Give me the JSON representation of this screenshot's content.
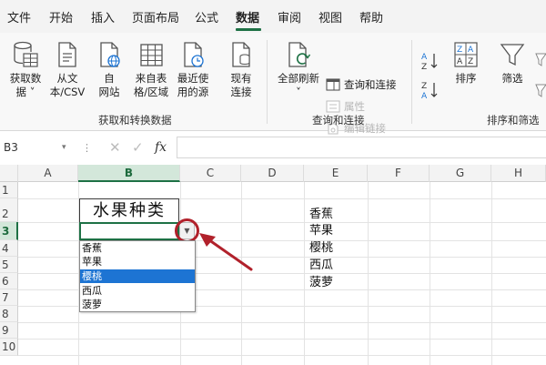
{
  "menu": {
    "tabs": [
      {
        "label": "文件"
      },
      {
        "label": "开始"
      },
      {
        "label": "插入"
      },
      {
        "label": "页面布局"
      },
      {
        "label": "公式"
      },
      {
        "label": "数据"
      },
      {
        "label": "审阅"
      },
      {
        "label": "视图"
      },
      {
        "label": "帮助"
      }
    ],
    "active_tab": "数据"
  },
  "ribbon": {
    "get_transform": {
      "group_label": "获取和转换数据",
      "buttons": [
        {
          "line1": "获取数",
          "line2": "据 ˅"
        },
        {
          "line1": "从文",
          "line2": "本/CSV"
        },
        {
          "line1": "自",
          "line2": "网站"
        },
        {
          "line1": "来自表",
          "line2": "格/区域"
        },
        {
          "line1": "最近使",
          "line2": "用的源"
        },
        {
          "line1": "现有",
          "line2": "连接"
        }
      ]
    },
    "queries": {
      "group_label": "查询和连接",
      "refresh_all": {
        "line1": "全部刷新",
        "line2": "˅"
      },
      "items": [
        {
          "label": "查询和连接"
        },
        {
          "label": "属性"
        },
        {
          "label": "编辑链接"
        }
      ]
    },
    "sort_filter": {
      "group_label": "排序和筛选",
      "sort_label": "排序",
      "filter_label": "筛选"
    }
  },
  "formula_bar": {
    "name_box": "B3",
    "fx": "fx",
    "value": ""
  },
  "sheet": {
    "columns": [
      "A",
      "B",
      "C",
      "D",
      "E",
      "F",
      "G",
      "H"
    ],
    "selected_column": "B",
    "rows": [
      "1",
      "2",
      "3",
      "4",
      "5",
      "6",
      "7",
      "8",
      "9",
      "10"
    ],
    "selected_row": "3",
    "title": "水果种类",
    "e_column": [
      "香蕉",
      "苹果",
      "樱桃",
      "西瓜",
      "菠萝"
    ]
  },
  "dropdown": {
    "options": [
      "香蕉",
      "苹果",
      "樱桃",
      "西瓜",
      "菠萝"
    ],
    "selected_index": 2
  },
  "colors": {
    "accent": "#1e7145",
    "annotation": "#b1212b",
    "selection": "#1d74d3"
  }
}
